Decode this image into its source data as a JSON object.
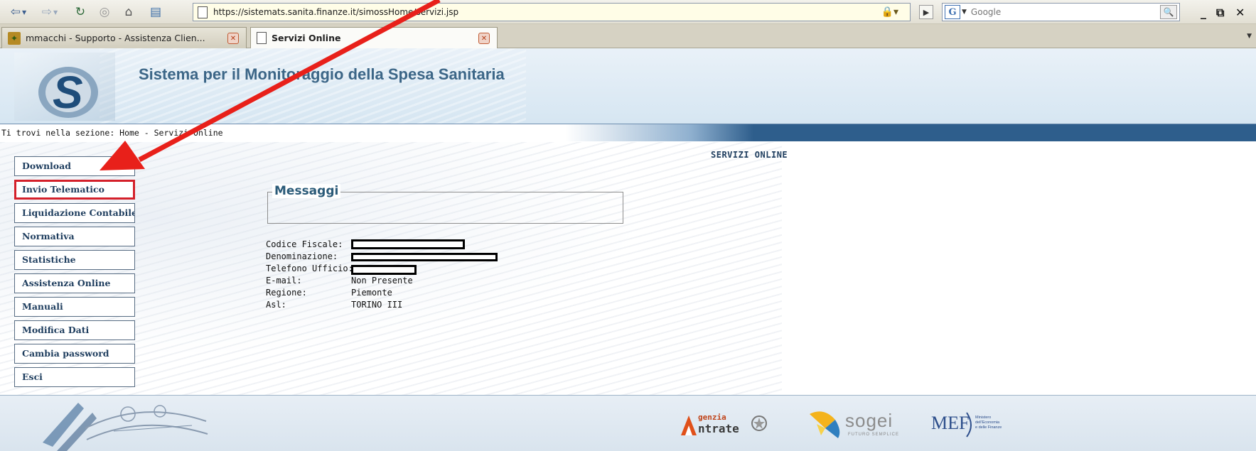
{
  "browser": {
    "url": "https://sistemats.sanita.finanze.it/simossHome/servizi.jsp",
    "search_placeholder": "Google",
    "tabs": [
      {
        "label": "mmacchi - Supporto - Assistenza Clien..."
      },
      {
        "label": "Servizi Online"
      }
    ]
  },
  "header": {
    "title": "Sistema per il Monitoraggio della Spesa Sanitaria"
  },
  "breadcrumb": "Ti trovi nella sezione: Home - Servizi Online",
  "section_title": "SERVIZI ONLINE",
  "menu": [
    {
      "label": "Download"
    },
    {
      "label": "Invio Telematico"
    },
    {
      "label": "Liquidazione Contabile"
    },
    {
      "label": "Normativa"
    },
    {
      "label": "Statistiche"
    },
    {
      "label": "Assistenza Online"
    },
    {
      "label": "Manuali"
    },
    {
      "label": "Modifica Dati"
    },
    {
      "label": "Cambia password"
    },
    {
      "label": "Esci"
    }
  ],
  "messaggi": {
    "title": "Messaggi"
  },
  "info": {
    "codice_fiscale": {
      "label": "Codice Fiscale:"
    },
    "denominazione": {
      "label": "Denominazione:"
    },
    "telefono": {
      "label": "Telefono Ufficio:"
    },
    "email": {
      "label": "E-mail:",
      "value": "Non Presente"
    },
    "regione": {
      "label": "Regione:",
      "value": "Piemonte"
    },
    "asl": {
      "label": "Asl:",
      "value": "TORINO III"
    }
  },
  "footer": {
    "agenzia_line1": "genzia",
    "agenzia_line2": "ntrate",
    "sogei": "sogei",
    "sogei_tagline": "FUTURO SEMPLICE",
    "mef": "MEF",
    "mef_line1": "Ministero",
    "mef_line2": "dell'Economia",
    "mef_line3": "e delle Finanze"
  },
  "colors": {
    "header_title": "#3c6687",
    "menu_text": "#1e3d5e",
    "highlight": "#d4202a",
    "annotation_arrow": "#e8201a"
  }
}
